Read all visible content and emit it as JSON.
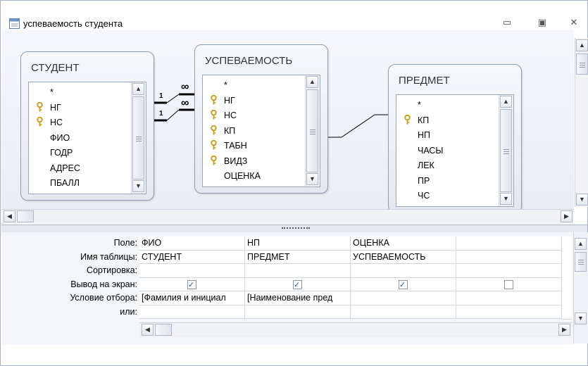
{
  "window": {
    "title": "успеваемость студента",
    "controls": [
      "minimize-icon",
      "restore-icon",
      "close-icon"
    ]
  },
  "tables": [
    {
      "title": "СТУДЕНТ",
      "fields": [
        {
          "name": "*",
          "key": false
        },
        {
          "name": "НГ",
          "key": true
        },
        {
          "name": "НС",
          "key": true
        },
        {
          "name": "ФИО",
          "key": false
        },
        {
          "name": "ГОДР",
          "key": false
        },
        {
          "name": "АДРЕС",
          "key": false
        },
        {
          "name": "ПБАЛЛ",
          "key": false
        }
      ]
    },
    {
      "title": "УСПЕВАЕМОСТЬ",
      "fields": [
        {
          "name": "*",
          "key": false
        },
        {
          "name": "НГ",
          "key": true
        },
        {
          "name": "НС",
          "key": true
        },
        {
          "name": "КП",
          "key": true
        },
        {
          "name": "ТАБН",
          "key": true
        },
        {
          "name": "ВИДЗ",
          "key": true
        },
        {
          "name": "ОЦЕНКА",
          "key": false
        }
      ]
    },
    {
      "title": "ПРЕДМЕТ",
      "fields": [
        {
          "name": "*",
          "key": false
        },
        {
          "name": "КП",
          "key": true
        },
        {
          "name": "НП",
          "key": false
        },
        {
          "name": "ЧАСЫ",
          "key": false
        },
        {
          "name": "ЛЕК",
          "key": false
        },
        {
          "name": "ПР",
          "key": false
        },
        {
          "name": "ЧС",
          "key": false
        }
      ]
    }
  ],
  "relations": {
    "one_label": "1",
    "many_label": "∞"
  },
  "grid": {
    "row_labels": [
      "Поле:",
      "Имя таблицы:",
      "Сортировка:",
      "Вывод на экран:",
      "Условие отбора:",
      "или:"
    ],
    "columns": [
      {
        "field": "ФИО",
        "table": "СТУДЕНТ",
        "sort": "",
        "show": true,
        "criteria": "[Фамилия и инициал",
        "or": ""
      },
      {
        "field": "НП",
        "table": "ПРЕДМЕТ",
        "sort": "",
        "show": true,
        "criteria": "[Наименование пред",
        "or": ""
      },
      {
        "field": "ОЦЕНКА",
        "table": "УСПЕВАЕМОСТЬ",
        "sort": "",
        "show": true,
        "criteria": "",
        "or": ""
      },
      {
        "field": "",
        "table": "",
        "sort": "",
        "show": false,
        "criteria": "",
        "or": ""
      }
    ]
  },
  "colors": {
    "key_icon": "#c9a227",
    "border": "#8f9db2"
  }
}
